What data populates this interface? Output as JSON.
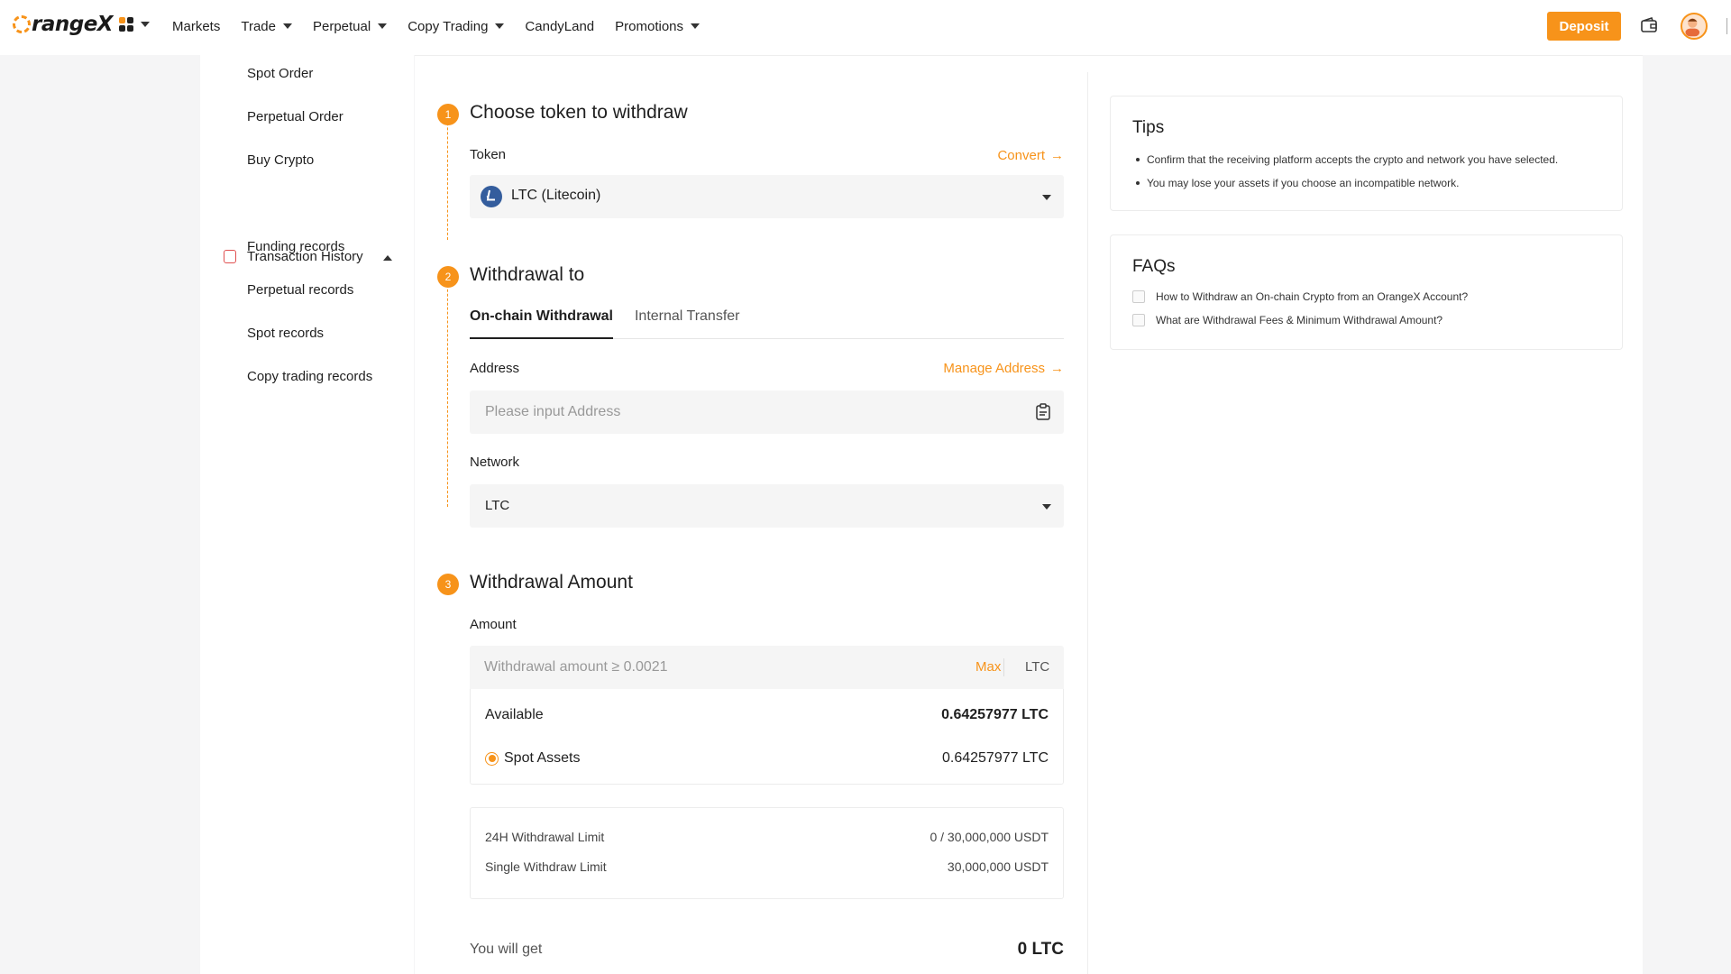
{
  "brand": {
    "name": "rangeX",
    "accent": "#f7931a"
  },
  "nav": {
    "items": [
      {
        "label": "Markets",
        "has_caret": false
      },
      {
        "label": "Trade",
        "has_caret": true
      },
      {
        "label": "Perpetual",
        "has_caret": true
      },
      {
        "label": "Copy Trading",
        "has_caret": true
      },
      {
        "label": "CandyLand",
        "has_caret": false
      },
      {
        "label": "Promotions",
        "has_caret": true
      }
    ],
    "deposit_label": "Deposit"
  },
  "sidebar": {
    "items": [
      "Spot Order",
      "Perpetual Order",
      "Buy Crypto"
    ],
    "history_label": "Transaction History",
    "history_items": [
      "Funding records",
      "Perpetual records",
      "Spot records",
      "Copy trading records"
    ]
  },
  "steps": {
    "s1": {
      "num": "1",
      "title": "Choose token to withdraw",
      "token_label": "Token",
      "convert": "Convert",
      "token_value": "LTC (Litecoin)"
    },
    "s2": {
      "num": "2",
      "title": "Withdrawal to",
      "tabs": [
        "On-chain Withdrawal",
        "Internal Transfer"
      ],
      "address_label": "Address",
      "manage_address": "Manage Address",
      "address_placeholder": "Please input Address",
      "network_label": "Network",
      "network_value": "LTC"
    },
    "s3": {
      "num": "3",
      "title": "Withdrawal Amount",
      "amount_label": "Amount",
      "amount_placeholder": "Withdrawal amount ≥ 0.0021",
      "max": "Max",
      "unit": "LTC",
      "available_label": "Available",
      "available_value": "0.64257977 LTC",
      "spot_label": "Spot Assets",
      "spot_value": "0.64257977 LTC",
      "limit24_label": "24H Withdrawal Limit",
      "limit24_value": "0 / 30,000,000 USDT",
      "single_label": "Single Withdraw Limit",
      "single_value": "30,000,000 USDT",
      "get_label": "You will get",
      "get_value": "0 LTC"
    }
  },
  "tips": {
    "title": "Tips",
    "items": [
      "Confirm that the receiving platform accepts the crypto and network you have selected.",
      "You may lose your assets if you choose an incompatible network."
    ]
  },
  "faqs": {
    "title": "FAQs",
    "items": [
      "How to Withdraw an On-chain Crypto from an OrangeX Account?",
      "What are Withdrawal Fees & Minimum Withdrawal Amount?"
    ]
  }
}
